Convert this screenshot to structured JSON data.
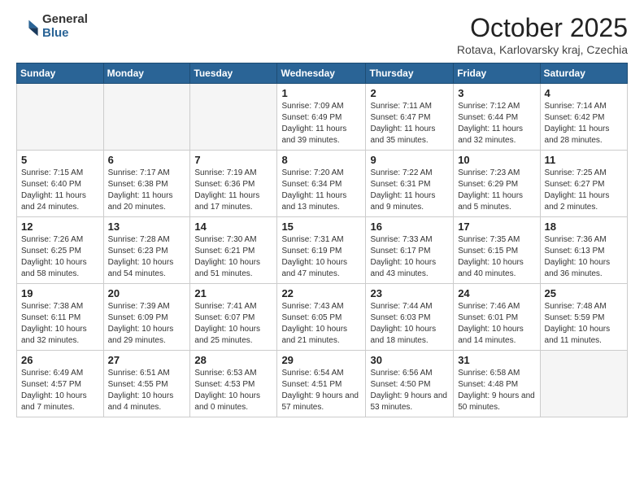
{
  "logo": {
    "general": "General",
    "blue": "Blue"
  },
  "header": {
    "month": "October 2025",
    "location": "Rotava, Karlovarsky kraj, Czechia"
  },
  "weekdays": [
    "Sunday",
    "Monday",
    "Tuesday",
    "Wednesday",
    "Thursday",
    "Friday",
    "Saturday"
  ],
  "weeks": [
    [
      {
        "day": "",
        "info": ""
      },
      {
        "day": "",
        "info": ""
      },
      {
        "day": "",
        "info": ""
      },
      {
        "day": "1",
        "info": "Sunrise: 7:09 AM\nSunset: 6:49 PM\nDaylight: 11 hours and 39 minutes."
      },
      {
        "day": "2",
        "info": "Sunrise: 7:11 AM\nSunset: 6:47 PM\nDaylight: 11 hours and 35 minutes."
      },
      {
        "day": "3",
        "info": "Sunrise: 7:12 AM\nSunset: 6:44 PM\nDaylight: 11 hours and 32 minutes."
      },
      {
        "day": "4",
        "info": "Sunrise: 7:14 AM\nSunset: 6:42 PM\nDaylight: 11 hours and 28 minutes."
      }
    ],
    [
      {
        "day": "5",
        "info": "Sunrise: 7:15 AM\nSunset: 6:40 PM\nDaylight: 11 hours and 24 minutes."
      },
      {
        "day": "6",
        "info": "Sunrise: 7:17 AM\nSunset: 6:38 PM\nDaylight: 11 hours and 20 minutes."
      },
      {
        "day": "7",
        "info": "Sunrise: 7:19 AM\nSunset: 6:36 PM\nDaylight: 11 hours and 17 minutes."
      },
      {
        "day": "8",
        "info": "Sunrise: 7:20 AM\nSunset: 6:34 PM\nDaylight: 11 hours and 13 minutes."
      },
      {
        "day": "9",
        "info": "Sunrise: 7:22 AM\nSunset: 6:31 PM\nDaylight: 11 hours and 9 minutes."
      },
      {
        "day": "10",
        "info": "Sunrise: 7:23 AM\nSunset: 6:29 PM\nDaylight: 11 hours and 5 minutes."
      },
      {
        "day": "11",
        "info": "Sunrise: 7:25 AM\nSunset: 6:27 PM\nDaylight: 11 hours and 2 minutes."
      }
    ],
    [
      {
        "day": "12",
        "info": "Sunrise: 7:26 AM\nSunset: 6:25 PM\nDaylight: 10 hours and 58 minutes."
      },
      {
        "day": "13",
        "info": "Sunrise: 7:28 AM\nSunset: 6:23 PM\nDaylight: 10 hours and 54 minutes."
      },
      {
        "day": "14",
        "info": "Sunrise: 7:30 AM\nSunset: 6:21 PM\nDaylight: 10 hours and 51 minutes."
      },
      {
        "day": "15",
        "info": "Sunrise: 7:31 AM\nSunset: 6:19 PM\nDaylight: 10 hours and 47 minutes."
      },
      {
        "day": "16",
        "info": "Sunrise: 7:33 AM\nSunset: 6:17 PM\nDaylight: 10 hours and 43 minutes."
      },
      {
        "day": "17",
        "info": "Sunrise: 7:35 AM\nSunset: 6:15 PM\nDaylight: 10 hours and 40 minutes."
      },
      {
        "day": "18",
        "info": "Sunrise: 7:36 AM\nSunset: 6:13 PM\nDaylight: 10 hours and 36 minutes."
      }
    ],
    [
      {
        "day": "19",
        "info": "Sunrise: 7:38 AM\nSunset: 6:11 PM\nDaylight: 10 hours and 32 minutes."
      },
      {
        "day": "20",
        "info": "Sunrise: 7:39 AM\nSunset: 6:09 PM\nDaylight: 10 hours and 29 minutes."
      },
      {
        "day": "21",
        "info": "Sunrise: 7:41 AM\nSunset: 6:07 PM\nDaylight: 10 hours and 25 minutes."
      },
      {
        "day": "22",
        "info": "Sunrise: 7:43 AM\nSunset: 6:05 PM\nDaylight: 10 hours and 21 minutes."
      },
      {
        "day": "23",
        "info": "Sunrise: 7:44 AM\nSunset: 6:03 PM\nDaylight: 10 hours and 18 minutes."
      },
      {
        "day": "24",
        "info": "Sunrise: 7:46 AM\nSunset: 6:01 PM\nDaylight: 10 hours and 14 minutes."
      },
      {
        "day": "25",
        "info": "Sunrise: 7:48 AM\nSunset: 5:59 PM\nDaylight: 10 hours and 11 minutes."
      }
    ],
    [
      {
        "day": "26",
        "info": "Sunrise: 6:49 AM\nSunset: 4:57 PM\nDaylight: 10 hours and 7 minutes."
      },
      {
        "day": "27",
        "info": "Sunrise: 6:51 AM\nSunset: 4:55 PM\nDaylight: 10 hours and 4 minutes."
      },
      {
        "day": "28",
        "info": "Sunrise: 6:53 AM\nSunset: 4:53 PM\nDaylight: 10 hours and 0 minutes."
      },
      {
        "day": "29",
        "info": "Sunrise: 6:54 AM\nSunset: 4:51 PM\nDaylight: 9 hours and 57 minutes."
      },
      {
        "day": "30",
        "info": "Sunrise: 6:56 AM\nSunset: 4:50 PM\nDaylight: 9 hours and 53 minutes."
      },
      {
        "day": "31",
        "info": "Sunrise: 6:58 AM\nSunset: 4:48 PM\nDaylight: 9 hours and 50 minutes."
      },
      {
        "day": "",
        "info": ""
      }
    ]
  ]
}
